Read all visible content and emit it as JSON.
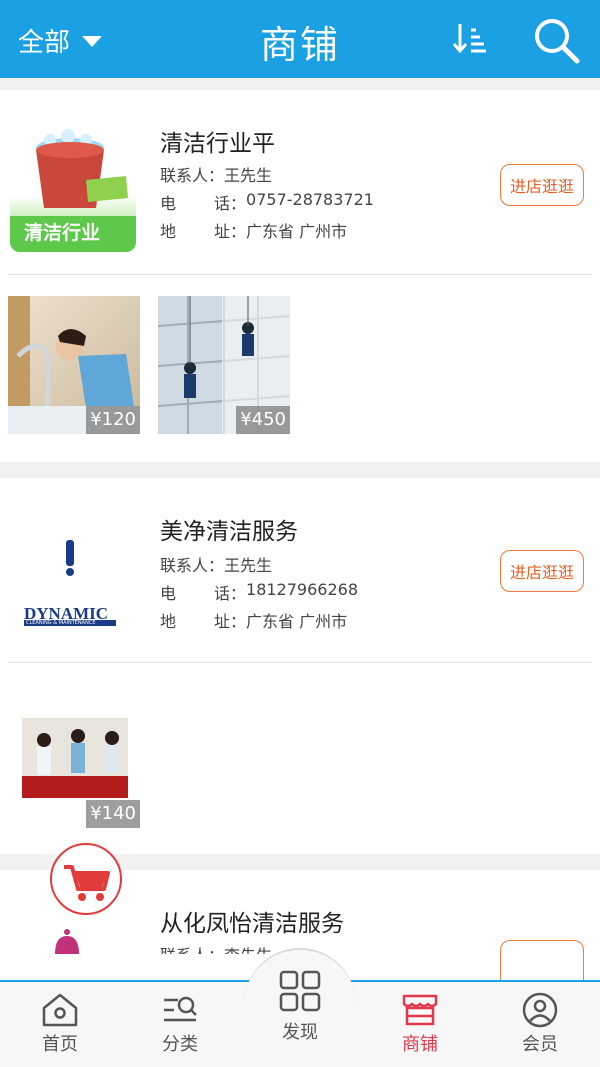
{
  "header": {
    "filter_label": "全部",
    "title": "商铺",
    "sort_icon": "sort-icon",
    "search_icon": "search-icon"
  },
  "shops": [
    {
      "name": "清洁行业平",
      "contact_label": "联系人：",
      "contact": "王先生",
      "phone_label_1": "电",
      "phone_label_2": "话：",
      "phone": "0757-28783721",
      "addr_label_1": "地",
      "addr_label_2": "址：",
      "address": "广东省 广州市",
      "visit_label": "进店逛逛",
      "logo_text": "清洁行业",
      "products": [
        {
          "price": "¥120"
        },
        {
          "price": "¥450"
        }
      ]
    },
    {
      "name": "美净清洁服务",
      "contact_label": "联系人：",
      "contact": "王先生",
      "phone_label_1": "电",
      "phone_label_2": "话：",
      "phone": "18127966268",
      "addr_label_1": "地",
      "addr_label_2": "址：",
      "address": "广东省 广州市",
      "visit_label": "进店逛逛",
      "logo_text": "DYNAMIC",
      "logo_subtext": "CLEANING & MAINTENANCE",
      "products": [
        {
          "price": "¥140"
        }
      ]
    },
    {
      "name": "从化凤怡清洁服务",
      "contact_label": "联系人：",
      "contact": "李先生"
    }
  ],
  "bottom_nav": [
    {
      "label": "首页",
      "icon": "home-icon"
    },
    {
      "label": "分类",
      "icon": "category-search-icon"
    },
    {
      "label": "发现",
      "icon": "grid-icon"
    },
    {
      "label": "商铺",
      "icon": "store-icon",
      "active": true
    },
    {
      "label": "会员",
      "icon": "user-icon"
    }
  ],
  "colors": {
    "header_bg": "#1aa0e3",
    "accent_red": "#e2384b",
    "button_orange": "#e8602a"
  }
}
